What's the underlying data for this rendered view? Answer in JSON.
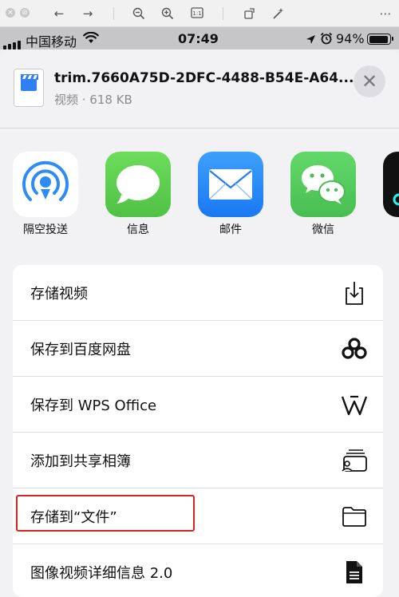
{
  "viewer_toolbar": {
    "icons": [
      "close-dot-icon",
      "zoom-dot-icon",
      "back-arrow-icon",
      "forward-arrow-icon",
      "zoom-out-icon",
      "zoom-in-icon",
      "fit-icon",
      "rotate-icon",
      "magic-wand-icon",
      "more-icon"
    ]
  },
  "status_bar": {
    "carrier": "中国移动",
    "time": "07:49",
    "battery": "94%",
    "battery_level": 0.94
  },
  "share_sheet": {
    "file_name": "trim.7660A75D-2DFC-4488-B54E-A64...",
    "file_meta": "视频 · 618 KB",
    "close_label": "✕",
    "apps": [
      {
        "label": "隔空投送",
        "icon": "airdrop-icon",
        "color": "#ffffff"
      },
      {
        "label": "信息",
        "icon": "messages-icon",
        "color": "#5fd156"
      },
      {
        "label": "邮件",
        "icon": "mail-icon",
        "color": "#2f8ef8"
      },
      {
        "label": "微信",
        "icon": "wechat-icon",
        "color": "#5fcf67"
      }
    ],
    "actions": [
      {
        "label": "存储视频",
        "icon": "save-video-icon"
      },
      {
        "label": "保存到百度网盘",
        "icon": "baidu-netdisk-icon"
      },
      {
        "label": "保存到 WPS Office",
        "icon": "wps-icon"
      },
      {
        "label": "添加到共享相簿",
        "icon": "shared-album-icon"
      },
      {
        "label": "存储到“文件”",
        "icon": "folder-icon"
      },
      {
        "label": "图像视频详细信息 2.0",
        "icon": "document-icon"
      }
    ]
  }
}
